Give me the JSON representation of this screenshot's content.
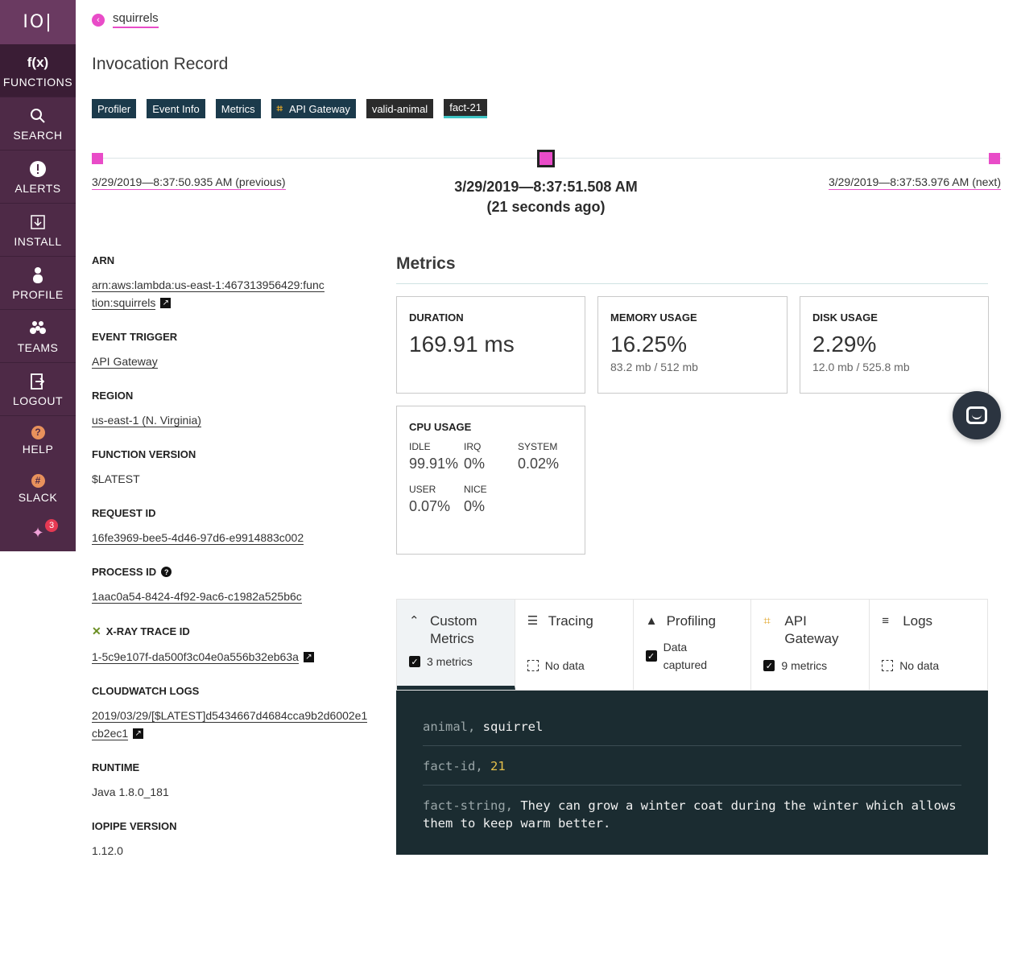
{
  "sidebar": {
    "logo": "IO|",
    "items": [
      {
        "icon": "f(x)",
        "label": "FUNCTIONS"
      },
      {
        "icon": "search-icon",
        "label": "SEARCH"
      },
      {
        "icon": "alert-icon",
        "label": "ALERTS"
      },
      {
        "icon": "install-icon",
        "label": "INSTALL"
      },
      {
        "icon": "profile-icon",
        "label": "PROFILE"
      },
      {
        "icon": "teams-icon",
        "label": "TEAMS"
      },
      {
        "icon": "logout-icon",
        "label": "LOGOUT"
      },
      {
        "icon": "help-icon",
        "label": "HELP"
      },
      {
        "icon": "slack-icon",
        "label": "SLACK"
      }
    ],
    "notif_count": "3"
  },
  "breadcrumb": {
    "back_label": "squirrels"
  },
  "page_title": "Invocation Record",
  "tags": [
    "Profiler",
    "Event Info",
    "Metrics",
    "API Gateway",
    "valid-animal",
    "fact-21"
  ],
  "timeline": {
    "previous": "3/29/2019—8:37:50.935 AM (previous)",
    "current": "3/29/2019—8:37:51.508 AM",
    "ago": "(21 seconds ago)",
    "next": "3/29/2019—8:37:53.976 AM (next)"
  },
  "details": {
    "arn_label": "ARN",
    "arn_value": "arn:aws:lambda:us-east-1:467313956429:function:squirrels",
    "trigger_label": "EVENT TRIGGER",
    "trigger_value": "API Gateway",
    "region_label": "REGION",
    "region_value": "us-east-1 (N. Virginia)",
    "version_label": "FUNCTION VERSION",
    "version_value": "$LATEST",
    "request_label": "REQUEST ID",
    "request_value": "16fe3969-bee5-4d46-97d6-e9914883c002",
    "process_label": "PROCESS ID",
    "process_value": "1aac0a54-8424-4f92-9ac6-c1982a525b6c",
    "xray_label": "X-RAY TRACE ID",
    "xray_value": "1-5c9e107f-da500f3c04e0a556b32eb63a",
    "cw_label": "CLOUDWATCH LOGS",
    "cw_value": "2019/03/29/[$LATEST]d5434667d4684cca9b2d6002e1cb2ec1",
    "runtime_label": "RUNTIME",
    "runtime_value": "Java 1.8.0_181",
    "iopipe_label": "IOPIPE VERSION",
    "iopipe_value": "1.12.0"
  },
  "metrics": {
    "title": "Metrics",
    "duration_label": "DURATION",
    "duration_value": "169.91 ms",
    "memory_label": "MEMORY USAGE",
    "memory_value": "16.25%",
    "memory_sub": "83.2 mb / 512 mb",
    "disk_label": "DISK USAGE",
    "disk_value": "2.29%",
    "disk_sub": "12.0 mb / 525.8 mb",
    "cpu_label": "CPU USAGE",
    "cpu": {
      "idle_k": "IDLE",
      "idle_v": "99.91%",
      "irq_k": "IRQ",
      "irq_v": "0%",
      "system_k": "SYSTEM",
      "system_v": "0.02%",
      "user_k": "USER",
      "user_v": "0.07%",
      "nice_k": "NICE",
      "nice_v": "0%"
    }
  },
  "plugins": [
    {
      "title": "Custom Metrics",
      "status": "3 metrics",
      "checked": true
    },
    {
      "title": "Tracing",
      "status": "No data",
      "checked": false
    },
    {
      "title": "Profiling",
      "status": "Data captured",
      "checked": true
    },
    {
      "title": "API Gateway",
      "status": "9 metrics",
      "checked": true
    },
    {
      "title": "Logs",
      "status": "No data",
      "checked": false
    }
  ],
  "custom_metrics": [
    {
      "key": "animal,",
      "value": "squirrel"
    },
    {
      "key": "fact-id,",
      "value": "21"
    },
    {
      "key": "fact-string,",
      "value": "They can grow a winter coat during the winter which allows them to keep warm better."
    }
  ]
}
